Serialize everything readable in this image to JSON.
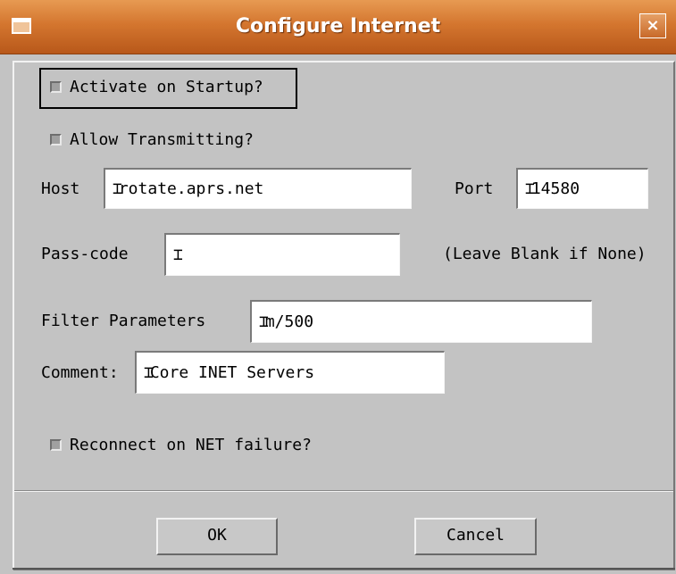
{
  "window": {
    "title": "Configure Internet",
    "close_glyph": "×",
    "accent_color": "#d4762f"
  },
  "checkboxes": {
    "activate_on_startup": {
      "label": "Activate on Startup?",
      "checked": false
    },
    "allow_transmitting": {
      "label": "Allow Transmitting?",
      "checked": false
    },
    "reconnect_on_failure": {
      "label": "Reconnect on NET failure?",
      "checked": false
    }
  },
  "fields": {
    "host": {
      "label": "Host",
      "value": "rotate.aprs.net"
    },
    "port": {
      "label": "Port",
      "value": "14580"
    },
    "passcode": {
      "label": "Pass-code",
      "value": "",
      "hint": "(Leave Blank if None)"
    },
    "filter": {
      "label": "Filter Parameters",
      "value": "m/500"
    },
    "comment": {
      "label": "Comment:",
      "value": "Core INET Servers"
    }
  },
  "buttons": {
    "ok": "OK",
    "cancel": "Cancel"
  }
}
